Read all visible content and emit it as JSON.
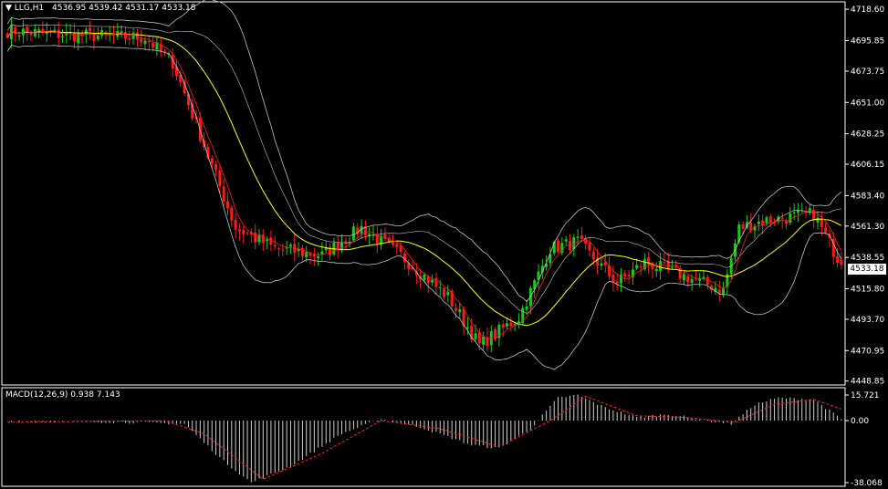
{
  "header": {
    "symbol": "LLG,H1",
    "ohlc": "4536.95 4539.42 4531.17 4533.18"
  },
  "current_price_label": "4533.18",
  "colors": {
    "background": "#000000",
    "bull": "#19c819",
    "bear": "#ff1a1a",
    "ma": "#ffff00",
    "bands": "#c0c0c0",
    "macd_hist": "#d0d0d0",
    "macd_signal": "#ff2020",
    "axis": "#ffffff"
  },
  "chart_data": [
    {
      "type": "candlestick",
      "title": "LLG,H1",
      "y_ticks": [
        "4718.60",
        "4695.85",
        "4673.75",
        "4651.00",
        "4628.25",
        "4606.15",
        "4583.40",
        "4561.30",
        "4538.55",
        "4515.80",
        "4493.70",
        "4470.95",
        "4448.85"
      ],
      "ylim": [
        4446,
        4724
      ],
      "last": {
        "open": 4536.95,
        "high": 4539.42,
        "low": 4531.17,
        "close": 4533.18
      },
      "indicators": [
        "Bollinger Bands",
        "Moving Average"
      ],
      "path_keypoints": [
        {
          "i": 0,
          "close": 4703
        },
        {
          "i": 15,
          "close": 4700
        },
        {
          "i": 35,
          "close": 4698
        },
        {
          "i": 42,
          "close": 4680
        },
        {
          "i": 50,
          "close": 4620
        },
        {
          "i": 58,
          "close": 4560
        },
        {
          "i": 68,
          "close": 4545
        },
        {
          "i": 80,
          "close": 4540
        },
        {
          "i": 90,
          "close": 4560
        },
        {
          "i": 100,
          "close": 4540
        },
        {
          "i": 112,
          "close": 4510
        },
        {
          "i": 120,
          "close": 4475
        },
        {
          "i": 130,
          "close": 4495
        },
        {
          "i": 138,
          "close": 4545
        },
        {
          "i": 145,
          "close": 4550
        },
        {
          "i": 155,
          "close": 4520
        },
        {
          "i": 162,
          "close": 4535
        },
        {
          "i": 172,
          "close": 4525
        },
        {
          "i": 182,
          "close": 4515
        },
        {
          "i": 186,
          "close": 4560
        },
        {
          "i": 192,
          "close": 4565
        },
        {
          "i": 205,
          "close": 4570
        },
        {
          "i": 212,
          "close": 4533
        }
      ]
    },
    {
      "type": "bar",
      "title": "MACD(12,26,9)",
      "macd_value": "0.938",
      "signal_value": "7.143",
      "y_ticks": [
        "15.721",
        "0.00",
        "-38.068"
      ],
      "ylim": [
        -38.068,
        15.721
      ],
      "series": [
        {
          "name": "MACD",
          "keypoints": [
            {
              "i": 0,
              "v": 0
            },
            {
              "i": 30,
              "v": -1
            },
            {
              "i": 45,
              "v": -2
            },
            {
              "i": 55,
              "v": -25
            },
            {
              "i": 62,
              "v": -38
            },
            {
              "i": 72,
              "v": -28
            },
            {
              "i": 85,
              "v": -8
            },
            {
              "i": 95,
              "v": 1
            },
            {
              "i": 105,
              "v": -4
            },
            {
              "i": 118,
              "v": -15
            },
            {
              "i": 125,
              "v": -17
            },
            {
              "i": 133,
              "v": -5
            },
            {
              "i": 140,
              "v": 14
            },
            {
              "i": 145,
              "v": 15.7
            },
            {
              "i": 152,
              "v": 8
            },
            {
              "i": 160,
              "v": 2
            },
            {
              "i": 168,
              "v": 4
            },
            {
              "i": 178,
              "v": 0
            },
            {
              "i": 184,
              "v": -2
            },
            {
              "i": 190,
              "v": 10
            },
            {
              "i": 196,
              "v": 14
            },
            {
              "i": 205,
              "v": 13
            },
            {
              "i": 212,
              "v": 0.938
            }
          ]
        },
        {
          "name": "Signal",
          "keypoints": [
            {
              "i": 0,
              "v": -1
            },
            {
              "i": 40,
              "v": 0
            },
            {
              "i": 50,
              "v": -8
            },
            {
              "i": 65,
              "v": -36
            },
            {
              "i": 80,
              "v": -20
            },
            {
              "i": 95,
              "v": 0
            },
            {
              "i": 110,
              "v": -5
            },
            {
              "i": 125,
              "v": -16
            },
            {
              "i": 138,
              "v": 0
            },
            {
              "i": 147,
              "v": 15
            },
            {
              "i": 160,
              "v": 3
            },
            {
              "i": 172,
              "v": 2
            },
            {
              "i": 185,
              "v": -1
            },
            {
              "i": 195,
              "v": 10
            },
            {
              "i": 205,
              "v": 13
            },
            {
              "i": 212,
              "v": 7.143
            }
          ]
        }
      ]
    }
  ]
}
